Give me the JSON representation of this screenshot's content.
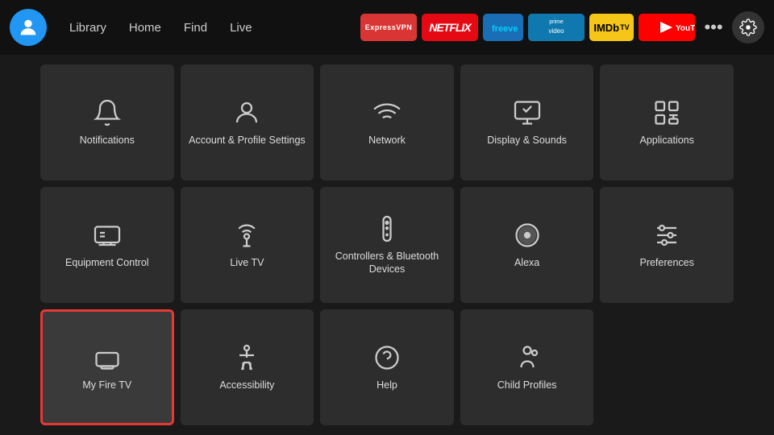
{
  "nav": {
    "links": [
      "Library",
      "Home",
      "Find",
      "Live"
    ],
    "apps": [
      {
        "name": "ExpressVPN",
        "label": "expressvpn-app"
      },
      {
        "name": "Netflix",
        "label": "netflix-app"
      },
      {
        "name": "Freevee",
        "label": "freevee-app"
      },
      {
        "name": "Prime Video",
        "label": "prime-app"
      },
      {
        "name": "IMDb TV",
        "label": "imdb-app"
      },
      {
        "name": "YouTube",
        "label": "youtube-app"
      }
    ],
    "more_label": "•••",
    "settings_label": "Settings"
  },
  "grid": {
    "items": [
      {
        "id": "notifications",
        "label": "Notifications",
        "icon": "bell"
      },
      {
        "id": "account",
        "label": "Account & Profile Settings",
        "icon": "person"
      },
      {
        "id": "network",
        "label": "Network",
        "icon": "wifi"
      },
      {
        "id": "display-sounds",
        "label": "Display & Sounds",
        "icon": "display"
      },
      {
        "id": "applications",
        "label": "Applications",
        "icon": "apps"
      },
      {
        "id": "equipment-control",
        "label": "Equipment Control",
        "icon": "tv"
      },
      {
        "id": "live-tv",
        "label": "Live TV",
        "icon": "antenna"
      },
      {
        "id": "controllers-bluetooth",
        "label": "Controllers & Bluetooth Devices",
        "icon": "remote"
      },
      {
        "id": "alexa",
        "label": "Alexa",
        "icon": "alexa"
      },
      {
        "id": "preferences",
        "label": "Preferences",
        "icon": "sliders"
      },
      {
        "id": "my-fire-tv",
        "label": "My Fire TV",
        "icon": "firetv",
        "selected": true
      },
      {
        "id": "accessibility",
        "label": "Accessibility",
        "icon": "accessibility"
      },
      {
        "id": "help",
        "label": "Help",
        "icon": "help"
      },
      {
        "id": "child-profiles",
        "label": "Child Profiles",
        "icon": "child"
      }
    ]
  }
}
